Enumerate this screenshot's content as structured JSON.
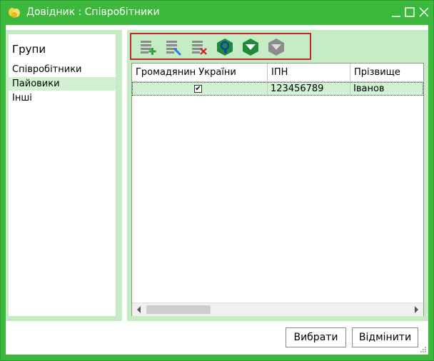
{
  "window": {
    "title": "Довідник : Співробітники"
  },
  "colors": {
    "accent": "#3cb83c",
    "selection": "#d2f0d2",
    "toolbar_border": "#c0272d"
  },
  "groups": {
    "title": "Групи",
    "items": [
      {
        "label": "Співробітники",
        "selected": false
      },
      {
        "label": "Пайовики",
        "selected": true
      },
      {
        "label": "Інші",
        "selected": false
      }
    ]
  },
  "toolbar": {
    "buttons": [
      {
        "icon": "add-record-icon"
      },
      {
        "icon": "edit-record-icon"
      },
      {
        "icon": "delete-record-icon"
      },
      {
        "icon": "search-icon"
      },
      {
        "icon": "filter-icon"
      },
      {
        "icon": "filter-clear-icon"
      }
    ]
  },
  "grid": {
    "columns": [
      "Громадянин України",
      "ІПН",
      "Прізвище"
    ],
    "rows": [
      {
        "citizen": true,
        "ipn": "123456789",
        "surname": "Іванов"
      }
    ]
  },
  "buttons": {
    "select": "Вибрати",
    "cancel": "Відмінити"
  }
}
